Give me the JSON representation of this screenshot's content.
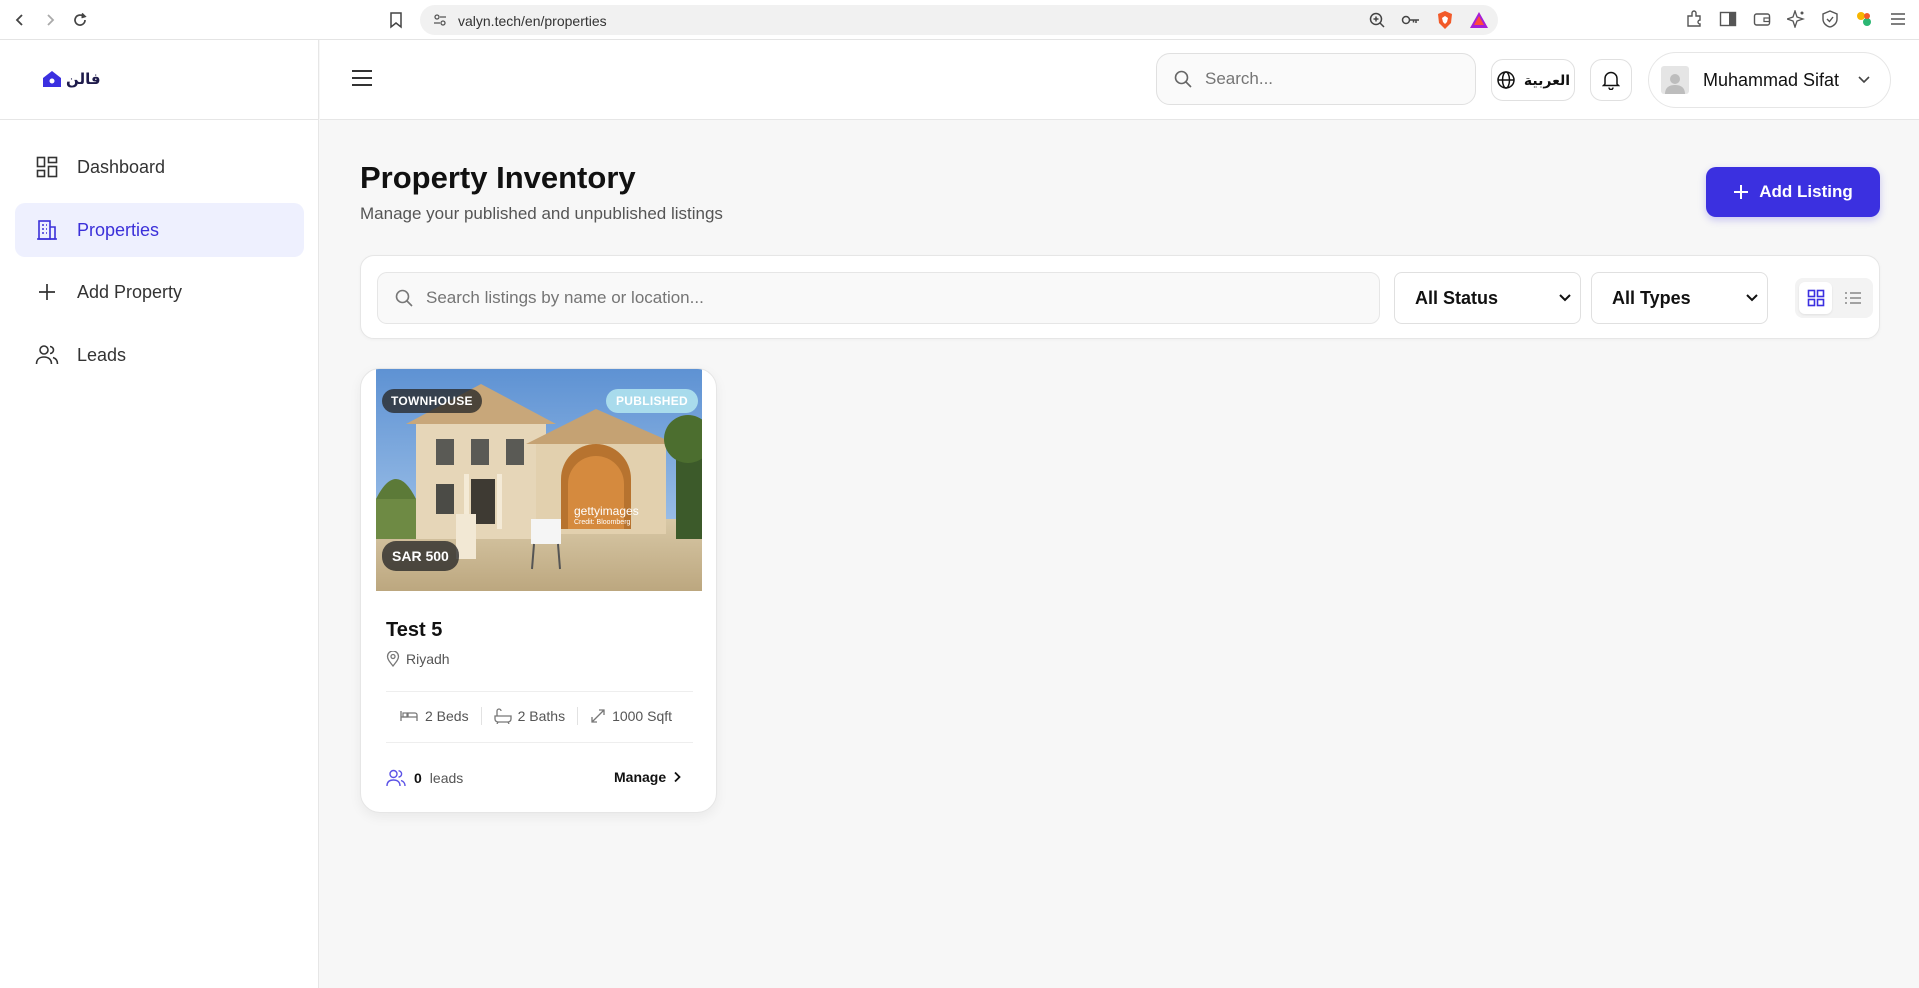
{
  "browser": {
    "url": "valyn.tech/en/properties"
  },
  "sidebar": {
    "logo_text": "فالن",
    "items": [
      {
        "label": "Dashboard",
        "icon": "dashboard-icon"
      },
      {
        "label": "Properties",
        "icon": "building-icon"
      },
      {
        "label": "Add Property",
        "icon": "plus-icon"
      },
      {
        "label": "Leads",
        "icon": "users-icon"
      }
    ]
  },
  "topbar": {
    "search_placeholder": "Search...",
    "language_label": "العربية",
    "user_name": "Muhammad Sifat"
  },
  "page": {
    "title": "Property Inventory",
    "subtitle": "Manage your published and unpublished listings",
    "add_listing_label": "Add Listing"
  },
  "filters": {
    "search_placeholder": "Search listings by name or location...",
    "status_selected": "All Status",
    "type_selected": "All Types"
  },
  "listings": [
    {
      "type": "TOWNHOUSE",
      "status": "PUBLISHED",
      "price": "SAR 500",
      "title": "Test 5",
      "location": "Riyadh",
      "beds": "2 Beds",
      "baths": "2 Baths",
      "area": "1000 Sqft",
      "leads_count": "0",
      "leads_label": "leads",
      "manage_label": "Manage",
      "watermark_main": "gettyimages",
      "watermark_sub": "Credit: Bloomberg"
    }
  ],
  "colors": {
    "accent": "#3b30e0",
    "active_bg": "#eef0fe"
  }
}
